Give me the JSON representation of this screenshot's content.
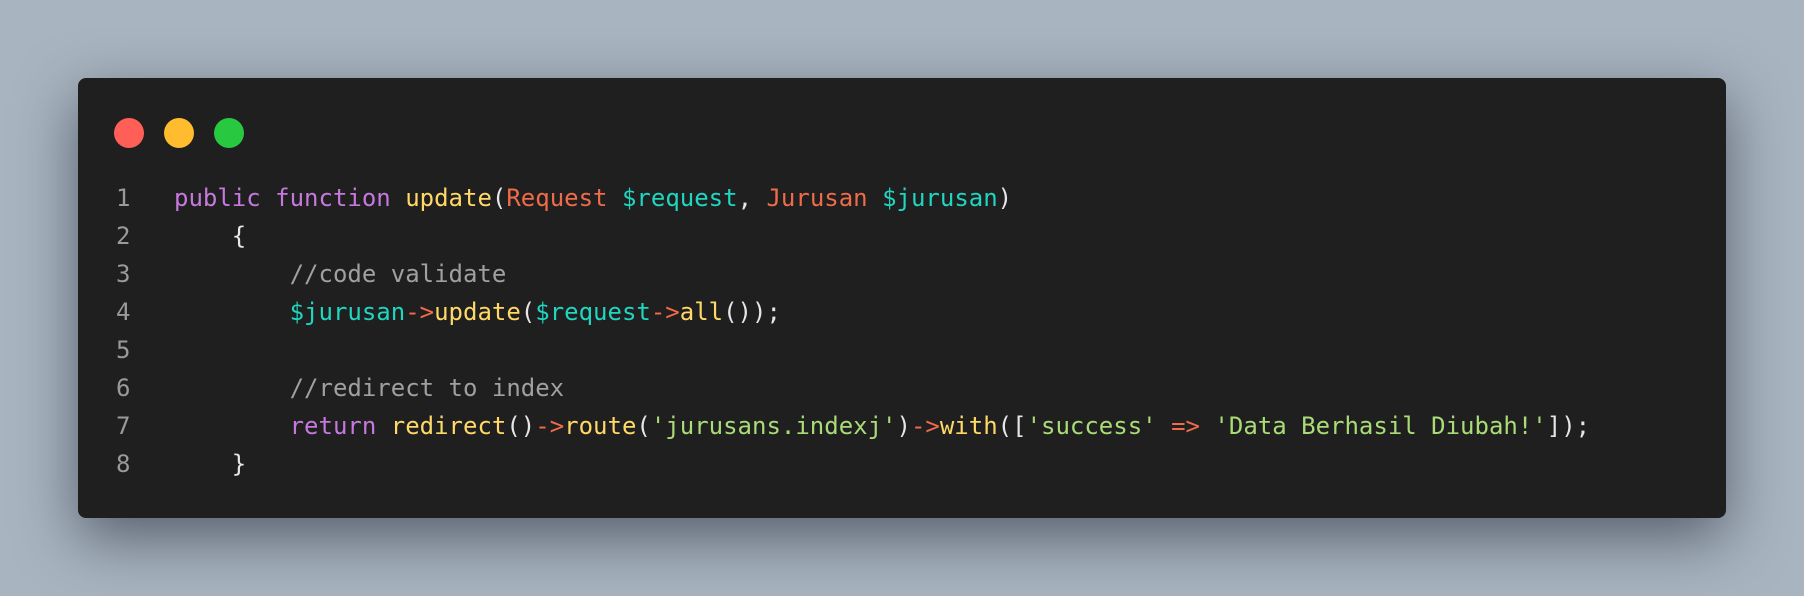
{
  "window": {
    "controls": [
      {
        "name": "close-dot",
        "color": "#ff5f57"
      },
      {
        "name": "minimize-dot",
        "color": "#febc2e"
      },
      {
        "name": "maximize-dot",
        "color": "#28c840"
      }
    ]
  },
  "syntax_colors": {
    "keyword": "#c678dd",
    "function": "#ffd866",
    "type": "#ef6b4a",
    "variable": "#1fd6c1",
    "string": "#a9dc76",
    "comment": "#a0a0a0",
    "operator": "#ef6b4a",
    "punct": "#e6e6e6"
  },
  "code": {
    "lines": [
      {
        "number": "1",
        "tokens": [
          {
            "t": "public",
            "c": "keyword"
          },
          {
            "t": " ",
            "c": "punct"
          },
          {
            "t": "function",
            "c": "keyword"
          },
          {
            "t": " ",
            "c": "punct"
          },
          {
            "t": "update",
            "c": "function"
          },
          {
            "t": "(",
            "c": "punct"
          },
          {
            "t": "Request",
            "c": "type"
          },
          {
            "t": " ",
            "c": "punct"
          },
          {
            "t": "$request",
            "c": "variable"
          },
          {
            "t": ", ",
            "c": "punct"
          },
          {
            "t": "Jurusan",
            "c": "type"
          },
          {
            "t": " ",
            "c": "punct"
          },
          {
            "t": "$jurusan",
            "c": "variable"
          },
          {
            "t": ")",
            "c": "punct"
          }
        ]
      },
      {
        "number": "2",
        "tokens": [
          {
            "t": "    {",
            "c": "punct"
          }
        ]
      },
      {
        "number": "3",
        "tokens": [
          {
            "t": "        ",
            "c": "punct"
          },
          {
            "t": "//code validate",
            "c": "comment"
          }
        ]
      },
      {
        "number": "4",
        "tokens": [
          {
            "t": "        ",
            "c": "punct"
          },
          {
            "t": "$jurusan",
            "c": "variable"
          },
          {
            "t": "->",
            "c": "operator"
          },
          {
            "t": "update",
            "c": "function"
          },
          {
            "t": "(",
            "c": "punct"
          },
          {
            "t": "$request",
            "c": "variable"
          },
          {
            "t": "->",
            "c": "operator"
          },
          {
            "t": "all",
            "c": "function"
          },
          {
            "t": "());",
            "c": "punct"
          }
        ]
      },
      {
        "number": "5",
        "tokens": []
      },
      {
        "number": "6",
        "tokens": [
          {
            "t": "        ",
            "c": "punct"
          },
          {
            "t": "//redirect to index",
            "c": "comment"
          }
        ]
      },
      {
        "number": "7",
        "tokens": [
          {
            "t": "        ",
            "c": "punct"
          },
          {
            "t": "return",
            "c": "keyword"
          },
          {
            "t": " ",
            "c": "punct"
          },
          {
            "t": "redirect",
            "c": "function"
          },
          {
            "t": "()",
            "c": "punct"
          },
          {
            "t": "->",
            "c": "operator"
          },
          {
            "t": "route",
            "c": "function"
          },
          {
            "t": "(",
            "c": "punct"
          },
          {
            "t": "'jurusans.indexj'",
            "c": "string"
          },
          {
            "t": ")",
            "c": "punct"
          },
          {
            "t": "->",
            "c": "operator"
          },
          {
            "t": "with",
            "c": "function"
          },
          {
            "t": "([",
            "c": "punct"
          },
          {
            "t": "'success'",
            "c": "string"
          },
          {
            "t": " ",
            "c": "punct"
          },
          {
            "t": "=>",
            "c": "operator"
          },
          {
            "t": " ",
            "c": "punct"
          },
          {
            "t": "'Data Berhasil Diubah!'",
            "c": "string"
          },
          {
            "t": "]);",
            "c": "punct"
          }
        ]
      },
      {
        "number": "8",
        "tokens": [
          {
            "t": "    }",
            "c": "punct"
          }
        ]
      }
    ]
  }
}
